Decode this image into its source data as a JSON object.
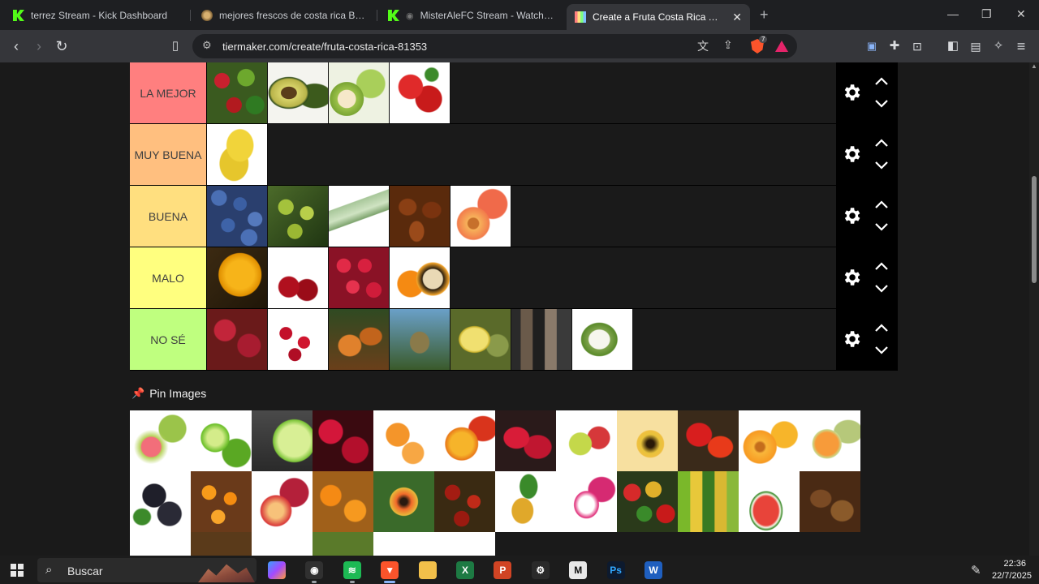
{
  "browser": {
    "tabs": [
      {
        "title": "terrez Stream - Kick Dashboard",
        "favicon": "kick-icon"
      },
      {
        "title": "mejores frescos de costa rica Bracket",
        "favicon": "bracket-icon"
      },
      {
        "title": "MisterAleFC Stream - Watch Live",
        "favicon": "kick-icon"
      },
      {
        "title": "Create a Fruta Costa Rica Tier Lis",
        "favicon": "tiermaker-icon",
        "active": true
      }
    ],
    "new_tab": "+",
    "url": "tiermaker.com/create/fruta-costa-rica-81353",
    "shield_badge": "7"
  },
  "tiers": [
    {
      "label": "LA MEJOR",
      "color": "#ff7f7f",
      "items": [
        "mixed-fruit",
        "avocado",
        "guava",
        "strawberry"
      ]
    },
    {
      "label": "MUY BUENA",
      "color": "#ffbf7f",
      "items": [
        "banana"
      ]
    },
    {
      "label": "BUENA",
      "color": "#ffdf7f",
      "items": [
        "blueberry",
        "nance",
        "sugarcane",
        "dates",
        "peach"
      ]
    },
    {
      "label": "MALO",
      "color": "#ffff7f",
      "items": [
        "starfruit",
        "cherry",
        "raspberry",
        "granadilla"
      ]
    },
    {
      "label": "NO SÉ",
      "color": "#bfff7f",
      "items": [
        "mamon-chino",
        "cranberry",
        "cacao",
        "pejibaye-palm",
        "durian",
        "palm-trunk",
        "soursop"
      ]
    }
  ],
  "pin": {
    "title": "Pin Images"
  },
  "pool": [
    "guava-pink",
    "lime",
    "lime-half",
    "rambutan",
    "tangerine",
    "mango",
    "water-apple",
    "apple",
    "passion-fruit",
    "cashew-apple",
    "peach-orange",
    "cantaloupe",
    "blackberry",
    "kumquat",
    "nectarine",
    "mandarin",
    "papaya",
    "jocote",
    "pineapple",
    "dragon-fruit",
    "mixed-market",
    "banana-varieties",
    "watermelon",
    "tamarind",
    "tomato",
    "orange-pile",
    "grapes",
    "green-fruit",
    "pear",
    "coconut"
  ],
  "taskbar": {
    "search_placeholder": "Buscar",
    "time": "22:36",
    "date": "22/7/2025",
    "apps": [
      "copilot-icon",
      "obs-icon",
      "spotify-icon",
      "brave-icon",
      "folder-icon",
      "excel-icon",
      "powerpoint-icon",
      "steam-icon",
      "capcut-icon",
      "photoshop-icon",
      "word-icon"
    ]
  }
}
